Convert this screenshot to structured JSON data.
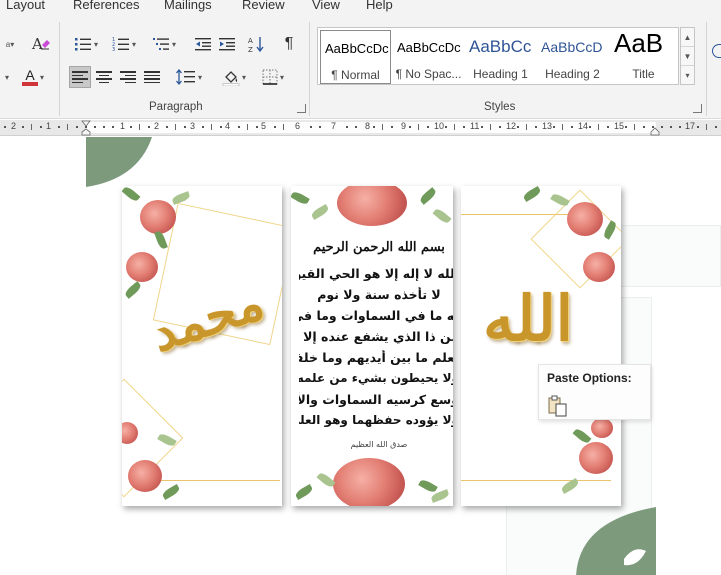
{
  "menu_tabs": [
    "Layout",
    "References",
    "Mailings",
    "Review",
    "View",
    "Help"
  ],
  "ribbon": {
    "paragraph_group_label": "Paragraph",
    "styles_group_label": "Styles",
    "pilcrow_glyph": "¶",
    "font_color_glyph": "A",
    "font_color_value": "#d13438",
    "styles": [
      {
        "sample": "AaBbCcDc",
        "name": "¶ Normal",
        "selected": true
      },
      {
        "sample": "AaBbCcDc",
        "name": "¶ No Spac...",
        "selected": false
      },
      {
        "sample": "AaBbCc",
        "name": "Heading 1",
        "selected": false
      },
      {
        "sample": "AaBbCcD",
        "name": "Heading 2",
        "selected": false
      },
      {
        "sample": "AaB",
        "name": "Title",
        "selected": false
      }
    ]
  },
  "ruler": {
    "numbers": [
      "2",
      "1",
      "1",
      "2",
      "3",
      "4",
      "5",
      "6",
      "7",
      "8",
      "9",
      "10",
      "11",
      "12",
      "13",
      "14",
      "15",
      "17"
    ]
  },
  "document": {
    "panel_left_text": "محمد",
    "panel_right_text": "الله",
    "basmala": "بسم الله الرحمن الرحيم",
    "ayah_lines": [
      "الله لا إله إلا هو الحي القيوم",
      "لا تأخذه سنة ولا نوم",
      "له ما في السماوات وما في الأرض",
      "من ذا الذي يشفع عنده إلا بإذنه",
      "يعلم ما بين أيديهم وما خلفهم",
      "ولا يحيطون بشيء من علمه إلا بما شاء",
      "وسع كرسيه السماوات والأرض",
      "ولا يؤوده حفظهما وهو العلي العظيم"
    ],
    "footer_line": "صدق الله العظيم",
    "colors": {
      "gold": "#c9962c",
      "rose": "#e27d72",
      "leaf": "#6f9a5a",
      "sage": "#7d9a7d"
    }
  },
  "paste_options": {
    "title": "Paste Options:"
  }
}
